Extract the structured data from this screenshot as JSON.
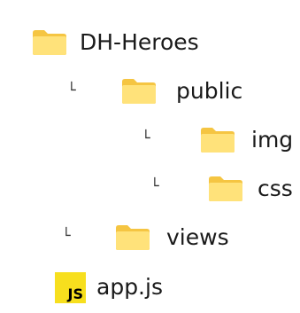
{
  "tree": {
    "root": {
      "label": "DH-Heroes",
      "icon": "folder-icon"
    },
    "public": {
      "label": "public",
      "icon": "folder-icon"
    },
    "img": {
      "label": "img",
      "icon": "folder-icon"
    },
    "css": {
      "label": "css",
      "icon": "folder-icon"
    },
    "views": {
      "label": "views",
      "icon": "folder-icon"
    },
    "appjs": {
      "label": "app.js",
      "icon": "js-file-icon",
      "badge": "JS"
    }
  },
  "connector_glyph": "└",
  "colors": {
    "folder_back": "#f5c542",
    "folder_front": "#ffe27a",
    "js_bg": "#f7df1e",
    "js_text": "#000000",
    "text": "#1a1a1a"
  }
}
